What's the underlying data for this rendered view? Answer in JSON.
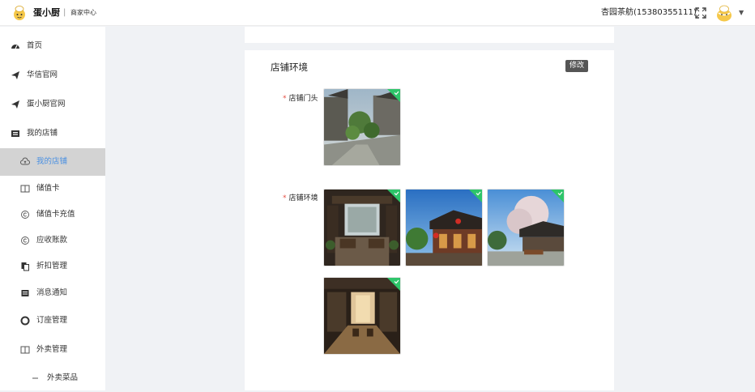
{
  "header": {
    "brand_name": "蛋小厨",
    "separator": "|",
    "brand_sub": "商家中心",
    "user_name": "杏园茶舫(15380355111)",
    "caret": "▼"
  },
  "sidebar": {
    "items": [
      {
        "label": "首页",
        "icon": "dashboard-icon"
      },
      {
        "label": "华信官网",
        "icon": "send-icon"
      },
      {
        "label": "蛋小厨官网",
        "icon": "send-icon"
      },
      {
        "label": "我的店铺",
        "icon": "store-icon"
      },
      {
        "label": "我的店铺",
        "icon": "cloud-icon",
        "active": true
      },
      {
        "label": "储值卡",
        "icon": "book-icon"
      },
      {
        "label": "储值卡充值",
        "icon": "copyright-icon"
      },
      {
        "label": "应收账款",
        "icon": "copyright-icon"
      },
      {
        "label": "折扣管理",
        "icon": "copy-icon"
      },
      {
        "label": "消息通知",
        "icon": "message-icon"
      },
      {
        "label": "订座管理",
        "icon": "lifebuoy-icon"
      },
      {
        "label": "外卖管理",
        "icon": "book-icon"
      },
      {
        "label": "外卖菜品",
        "icon": "dash-icon"
      }
    ]
  },
  "main": {
    "section_title": "店铺环境",
    "edit_label": "修改",
    "fields": [
      {
        "required": "*",
        "label": "店铺门头"
      },
      {
        "required": "*",
        "label": "店铺环境"
      }
    ]
  },
  "colors": {
    "accent": "#4a90e2",
    "active_bg": "#d3d3d3",
    "required": "#e54d42",
    "check_badge": "#2ec56a",
    "edit_button": "#555555"
  }
}
